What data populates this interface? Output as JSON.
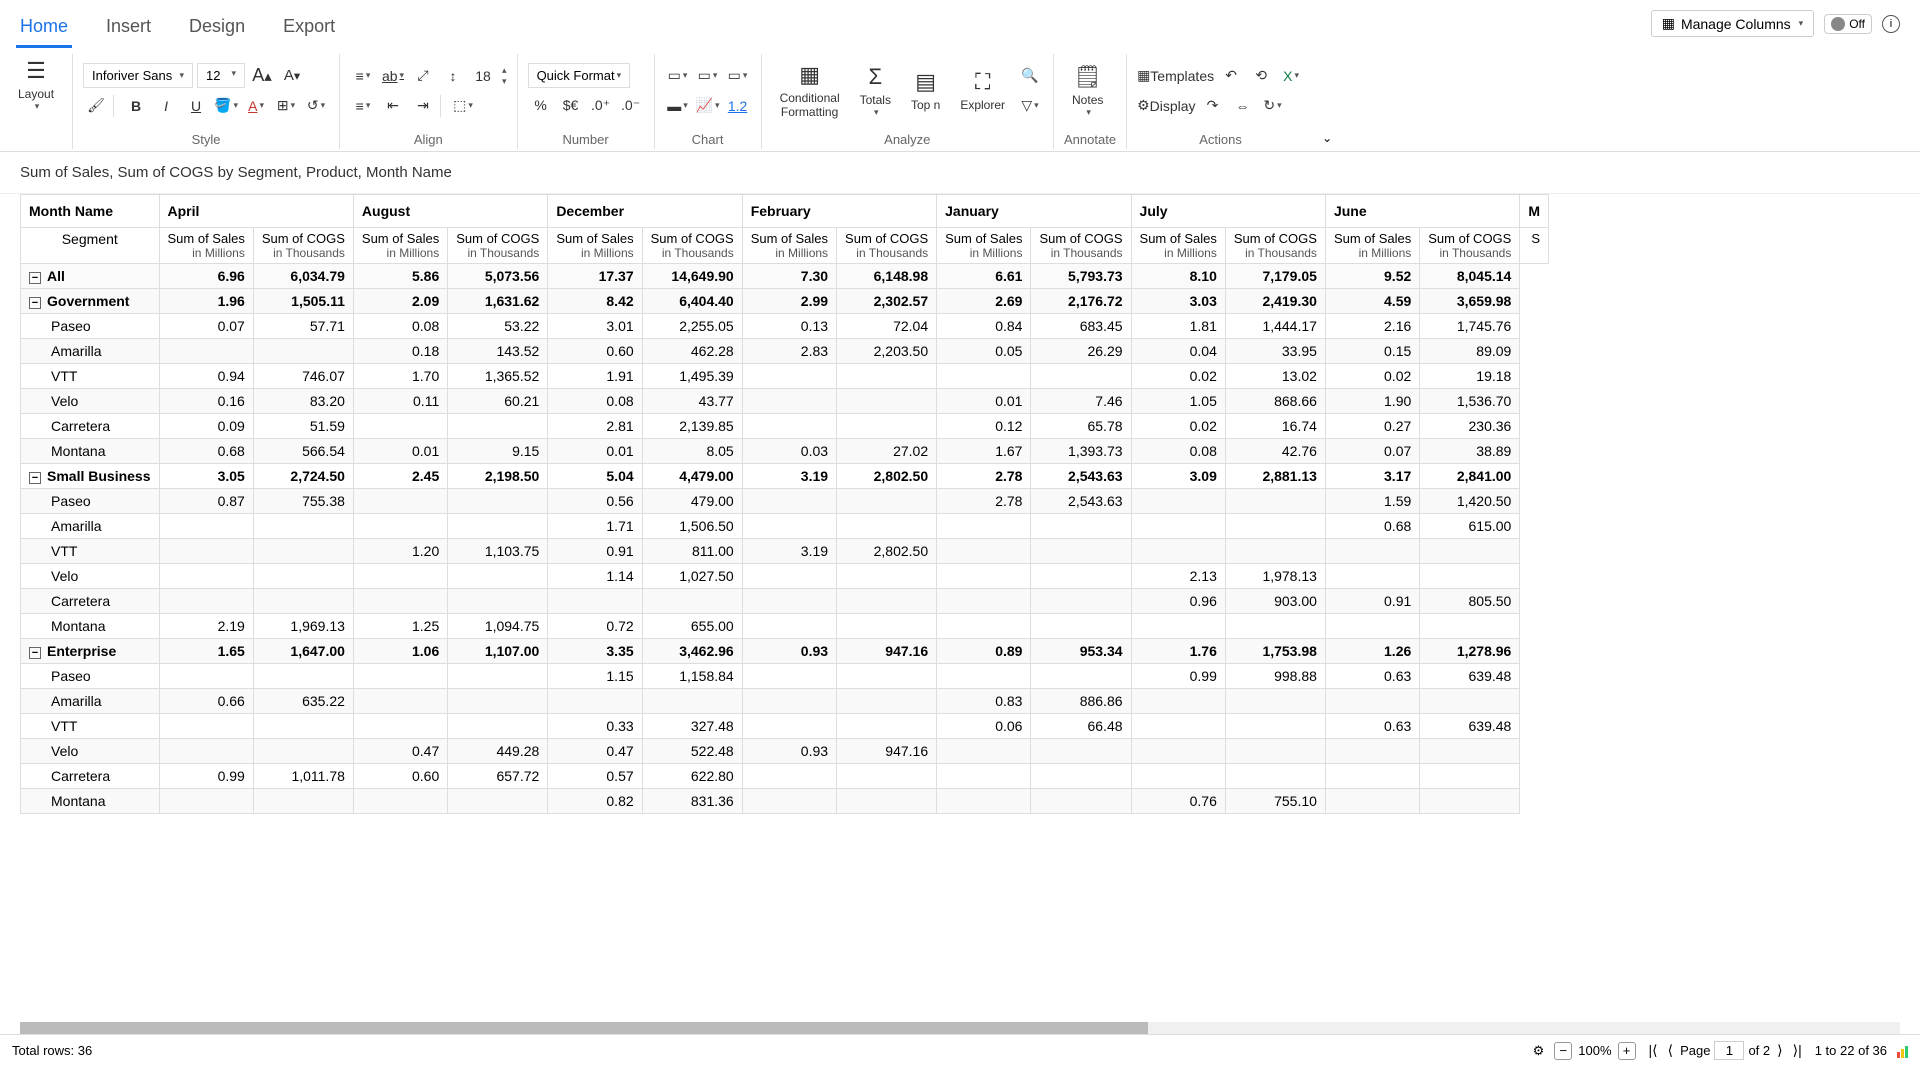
{
  "tabs": {
    "home": "Home",
    "insert": "Insert",
    "design": "Design",
    "export": "Export"
  },
  "topControls": {
    "manageColumns": "Manage Columns",
    "toggleOff": "Off",
    "info": "i"
  },
  "ribbon": {
    "layout": "Layout",
    "font": {
      "family": "Inforiver Sans",
      "size": "12"
    },
    "fontInc": "A",
    "fontDec": "A",
    "abc": "ab",
    "fontHeight": "18",
    "quickFormat": "Quick Format",
    "lineSpacing": "1.2",
    "conditional": "Conditional\nFormatting",
    "totals": "Totals",
    "topn": "Top n",
    "explorer": "Explorer",
    "notes": "Notes",
    "templates": "Templates",
    "display": "Display",
    "groups": {
      "style": "Style",
      "align": "Align",
      "number": "Number",
      "chart": "Chart",
      "analyze": "Analyze",
      "annotate": "Annotate",
      "actions": "Actions"
    }
  },
  "title": "Sum of Sales, Sum of COGS by Segment, Product, Month Name",
  "headers": {
    "monthName": "Month Name",
    "segment": "Segment",
    "months": [
      "April",
      "August",
      "December",
      "February",
      "January",
      "July",
      "June",
      "M"
    ],
    "sales": "Sum of Sales",
    "salesUnit": "in Millions",
    "cogs": "Sum of COGS",
    "cogsUnit": "in Thousands"
  },
  "rows": [
    {
      "level": "all",
      "label": "All",
      "v": [
        "6.96",
        "6,034.79",
        "5.86",
        "5,073.56",
        "17.37",
        "14,649.90",
        "7.30",
        "6,148.98",
        "6.61",
        "5,793.73",
        "8.10",
        "7,179.05",
        "9.52",
        "8,045.14"
      ]
    },
    {
      "level": "group",
      "label": "Government",
      "v": [
        "1.96",
        "1,505.11",
        "2.09",
        "1,631.62",
        "8.42",
        "6,404.40",
        "2.99",
        "2,302.57",
        "2.69",
        "2,176.72",
        "3.03",
        "2,419.30",
        "4.59",
        "3,659.98"
      ]
    },
    {
      "level": "leaf",
      "label": "Paseo",
      "v": [
        "0.07",
        "57.71",
        "0.08",
        "53.22",
        "3.01",
        "2,255.05",
        "0.13",
        "72.04",
        "0.84",
        "683.45",
        "1.81",
        "1,444.17",
        "2.16",
        "1,745.76"
      ]
    },
    {
      "level": "leaf",
      "label": "Amarilla",
      "v": [
        "",
        "",
        "0.18",
        "143.52",
        "0.60",
        "462.28",
        "2.83",
        "2,203.50",
        "0.05",
        "26.29",
        "0.04",
        "33.95",
        "0.15",
        "89.09"
      ]
    },
    {
      "level": "leaf",
      "label": "VTT",
      "v": [
        "0.94",
        "746.07",
        "1.70",
        "1,365.52",
        "1.91",
        "1,495.39",
        "",
        "",
        "",
        "",
        "0.02",
        "13.02",
        "0.02",
        "19.18"
      ]
    },
    {
      "level": "leaf",
      "label": "Velo",
      "v": [
        "0.16",
        "83.20",
        "0.11",
        "60.21",
        "0.08",
        "43.77",
        "",
        "",
        "0.01",
        "7.46",
        "1.05",
        "868.66",
        "1.90",
        "1,536.70"
      ]
    },
    {
      "level": "leaf",
      "label": "Carretera",
      "v": [
        "0.09",
        "51.59",
        "",
        "",
        "2.81",
        "2,139.85",
        "",
        "",
        "0.12",
        "65.78",
        "0.02",
        "16.74",
        "0.27",
        "230.36"
      ]
    },
    {
      "level": "leaf",
      "label": "Montana",
      "v": [
        "0.68",
        "566.54",
        "0.01",
        "9.15",
        "0.01",
        "8.05",
        "0.03",
        "27.02",
        "1.67",
        "1,393.73",
        "0.08",
        "42.76",
        "0.07",
        "38.89"
      ]
    },
    {
      "level": "group",
      "label": "Small Business",
      "v": [
        "3.05",
        "2,724.50",
        "2.45",
        "2,198.50",
        "5.04",
        "4,479.00",
        "3.19",
        "2,802.50",
        "2.78",
        "2,543.63",
        "3.09",
        "2,881.13",
        "3.17",
        "2,841.00"
      ]
    },
    {
      "level": "leaf",
      "label": "Paseo",
      "v": [
        "0.87",
        "755.38",
        "",
        "",
        "0.56",
        "479.00",
        "",
        "",
        "2.78",
        "2,543.63",
        "",
        "",
        "1.59",
        "1,420.50"
      ]
    },
    {
      "level": "leaf",
      "label": "Amarilla",
      "v": [
        "",
        "",
        "",
        "",
        "1.71",
        "1,506.50",
        "",
        "",
        "",
        "",
        "",
        "",
        "0.68",
        "615.00"
      ]
    },
    {
      "level": "leaf",
      "label": "VTT",
      "v": [
        "",
        "",
        "1.20",
        "1,103.75",
        "0.91",
        "811.00",
        "3.19",
        "2,802.50",
        "",
        "",
        "",
        "",
        "",
        ""
      ]
    },
    {
      "level": "leaf",
      "label": "Velo",
      "v": [
        "",
        "",
        "",
        "",
        "1.14",
        "1,027.50",
        "",
        "",
        "",
        "",
        "2.13",
        "1,978.13",
        "",
        ""
      ]
    },
    {
      "level": "leaf",
      "label": "Carretera",
      "v": [
        "",
        "",
        "",
        "",
        "",
        "",
        "",
        "",
        "",
        "",
        "0.96",
        "903.00",
        "0.91",
        "805.50"
      ]
    },
    {
      "level": "leaf",
      "label": "Montana",
      "v": [
        "2.19",
        "1,969.13",
        "1.25",
        "1,094.75",
        "0.72",
        "655.00",
        "",
        "",
        "",
        "",
        "",
        "",
        "",
        ""
      ]
    },
    {
      "level": "group",
      "label": "Enterprise",
      "v": [
        "1.65",
        "1,647.00",
        "1.06",
        "1,107.00",
        "3.35",
        "3,462.96",
        "0.93",
        "947.16",
        "0.89",
        "953.34",
        "1.76",
        "1,753.98",
        "1.26",
        "1,278.96"
      ]
    },
    {
      "level": "leaf",
      "label": "Paseo",
      "v": [
        "",
        "",
        "",
        "",
        "1.15",
        "1,158.84",
        "",
        "",
        "",
        "",
        "0.99",
        "998.88",
        "0.63",
        "639.48"
      ]
    },
    {
      "level": "leaf",
      "label": "Amarilla",
      "v": [
        "0.66",
        "635.22",
        "",
        "",
        "",
        "",
        "",
        "",
        "0.83",
        "886.86",
        "",
        "",
        "",
        ""
      ]
    },
    {
      "level": "leaf",
      "label": "VTT",
      "v": [
        "",
        "",
        "",
        "",
        "0.33",
        "327.48",
        "",
        "",
        "0.06",
        "66.48",
        "",
        "",
        "0.63",
        "639.48"
      ]
    },
    {
      "level": "leaf",
      "label": "Velo",
      "v": [
        "",
        "",
        "0.47",
        "449.28",
        "0.47",
        "522.48",
        "0.93",
        "947.16",
        "",
        "",
        "",
        "",
        "",
        ""
      ]
    },
    {
      "level": "leaf",
      "label": "Carretera",
      "v": [
        "0.99",
        "1,011.78",
        "0.60",
        "657.72",
        "0.57",
        "622.80",
        "",
        "",
        "",
        "",
        "",
        "",
        "",
        ""
      ]
    },
    {
      "level": "leaf",
      "label": "Montana",
      "v": [
        "",
        "",
        "",
        "",
        "0.82",
        "831.36",
        "",
        "",
        "",
        "",
        "0.76",
        "755.10",
        "",
        ""
      ]
    }
  ],
  "status": {
    "totalRows": "Total rows: 36",
    "zoom": "100%",
    "pageLabel": "Page",
    "pageCurrent": "1",
    "pageOf": "of 2",
    "records": "1 to 22 of 36"
  }
}
